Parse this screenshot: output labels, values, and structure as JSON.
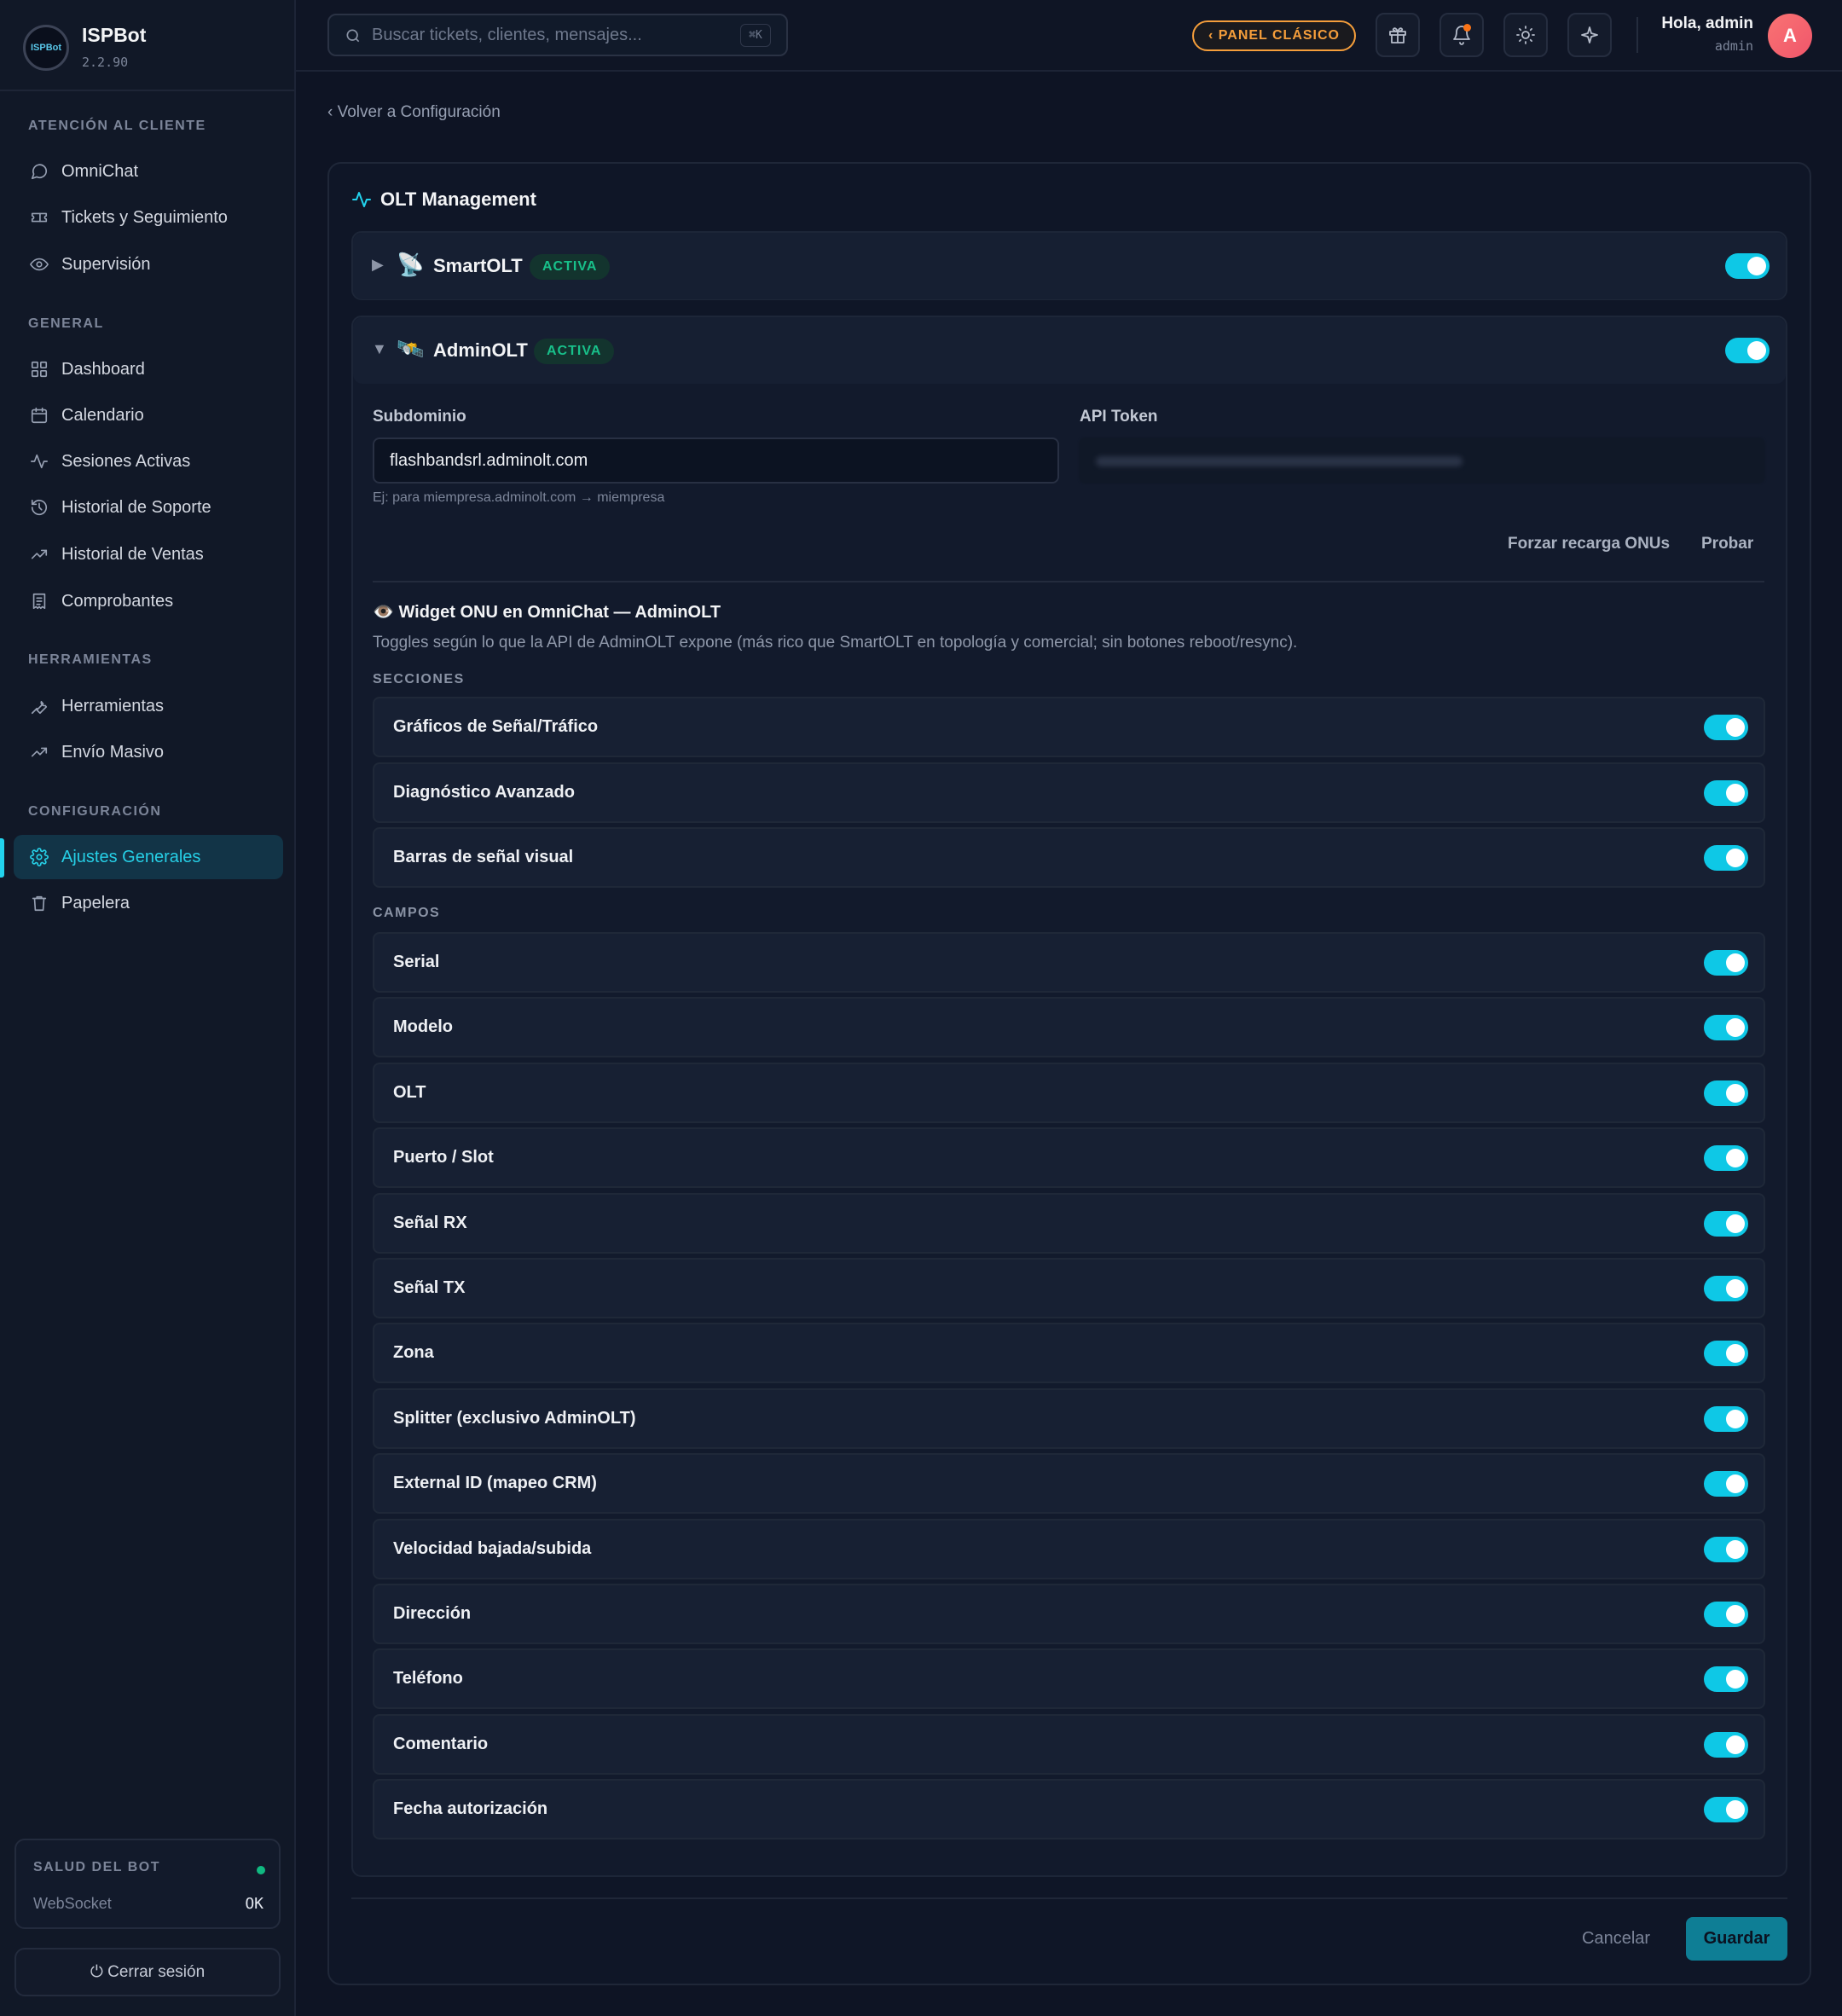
{
  "brand": {
    "name": "ISPBot",
    "version": "2.2.90",
    "logo_text": "ISPBot"
  },
  "sidebar": {
    "sections": [
      {
        "title": "ATENCIÓN AL CLIENTE",
        "items": [
          {
            "label": "OmniChat",
            "icon": "chat-bubble-icon"
          },
          {
            "label": "Tickets y Seguimiento",
            "icon": "ticket-icon"
          },
          {
            "label": "Supervisión",
            "icon": "eye-icon"
          }
        ]
      },
      {
        "title": "GENERAL",
        "items": [
          {
            "label": "Dashboard",
            "icon": "grid-icon"
          },
          {
            "label": "Calendario",
            "icon": "calendar-icon"
          },
          {
            "label": "Sesiones Activas",
            "icon": "activity-icon"
          },
          {
            "label": "Historial de Soporte",
            "icon": "history-icon"
          },
          {
            "label": "Historial de Ventas",
            "icon": "trending-up-icon"
          },
          {
            "label": "Comprobantes",
            "icon": "receipt-icon"
          }
        ]
      },
      {
        "title": "HERRAMIENTAS",
        "items": [
          {
            "label": "Herramientas",
            "icon": "wrench-icon"
          },
          {
            "label": "Envío Masivo",
            "icon": "trending-up-icon"
          }
        ]
      },
      {
        "title": "CONFIGURACIÓN",
        "items": [
          {
            "label": "Ajustes Generales",
            "icon": "gear-icon",
            "active": true
          },
          {
            "label": "Papelera",
            "icon": "trash-icon"
          }
        ]
      }
    ],
    "health": {
      "title": "SALUD DEL BOT",
      "status_color": "#10b981",
      "key": "WebSocket",
      "value": "OK"
    },
    "logout_label": "⏻ Cerrar sesión"
  },
  "topbar": {
    "search_placeholder": "Buscar tickets, clientes, mensajes...",
    "search_shortcut": "⌘K",
    "classic_label": "‹ PANEL CLÁSICO",
    "greeting": "Hola, admin",
    "role": "admin",
    "avatar_initial": "A"
  },
  "main": {
    "back_link": "‹ Volver a Configuración",
    "card_title": "OLT Management",
    "providers": [
      {
        "name": "SmartOLT",
        "emoji": "📡",
        "badge": "ACTIVA",
        "arrow": "▶",
        "enabled": true
      },
      {
        "name": "AdminOLT",
        "emoji": "🛰️",
        "badge": "ACTIVA",
        "arrow": "▼",
        "enabled": true
      }
    ],
    "form": {
      "subdomain_label": "Subdominio",
      "subdomain_value": "flashbandsrl.adminolt.com",
      "subdomain_hint": "Ej: para miempresa.adminolt.com → miempresa",
      "token_label": "API Token",
      "reload_label": "Forzar recarga ONUs",
      "test_label": "Probar"
    },
    "widget": {
      "title": "👁️ Widget ONU en OmniChat — AdminOLT",
      "description": "Toggles según lo que la API de AdminOLT expone (más rico que SmartOLT en topología y comercial; sin botones reboot/resync).",
      "sections_title": "SECCIONES",
      "sections": [
        "Gráficos de Señal/Tráfico",
        "Diagnóstico Avanzado",
        "Barras de señal visual"
      ],
      "fields_title": "CAMPOS",
      "fields": [
        "Serial",
        "Modelo",
        "OLT",
        "Puerto / Slot",
        "Señal RX",
        "Señal TX",
        "Zona",
        "Splitter (exclusivo AdminOLT)",
        "External ID (mapeo CRM)",
        "Velocidad bajada/subida",
        "Dirección",
        "Teléfono",
        "Comentario",
        "Fecha autorización"
      ]
    },
    "cancel_label": "Cancelar",
    "save_label": "Guardar"
  },
  "colors": {
    "accent": "#22d3ee",
    "toggle_on": "#0ec8e6",
    "badge_green": "#18c08a",
    "classic_orange": "#f59e3b"
  }
}
